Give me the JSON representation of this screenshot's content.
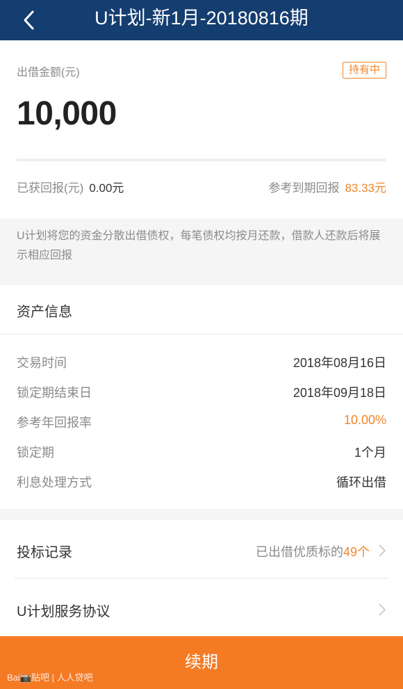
{
  "nav": {
    "title": "U计划-新1月-20180816期"
  },
  "summary": {
    "amount_label": "出借金额(元)",
    "status_badge": "持有中",
    "amount": "10,000",
    "earned_label": "已获回报(元)",
    "earned_value": "0.00元",
    "expected_label": "参考到期回报",
    "expected_value": "83.33元"
  },
  "notice": "U计划将您的资金分散出借债权，每笔债权均按月还款，借款人还款后将展示相应回报",
  "asset_info": {
    "heading": "资产信息",
    "rows": [
      {
        "label": "交易时间",
        "value": "2018年08月16日"
      },
      {
        "label": "锁定期结束日",
        "value": "2018年09月18日"
      },
      {
        "label": "参考年回报率",
        "value": "10.00%"
      },
      {
        "label": "锁定期",
        "value": "1个月"
      },
      {
        "label": "利息处理方式",
        "value": "循环出借"
      }
    ]
  },
  "links": {
    "bid_records_label": "投标记录",
    "bid_records_prefix": "已出借优质标的",
    "bid_records_count": "49个",
    "agreement_label": "U计划服务协议"
  },
  "action": {
    "renew_label": "续期"
  },
  "watermark": "Bai📷贴吧 | 人人贷吧",
  "colors": {
    "nav": "#153e70",
    "accent": "#f57a24",
    "highlight": "#f0862a"
  }
}
